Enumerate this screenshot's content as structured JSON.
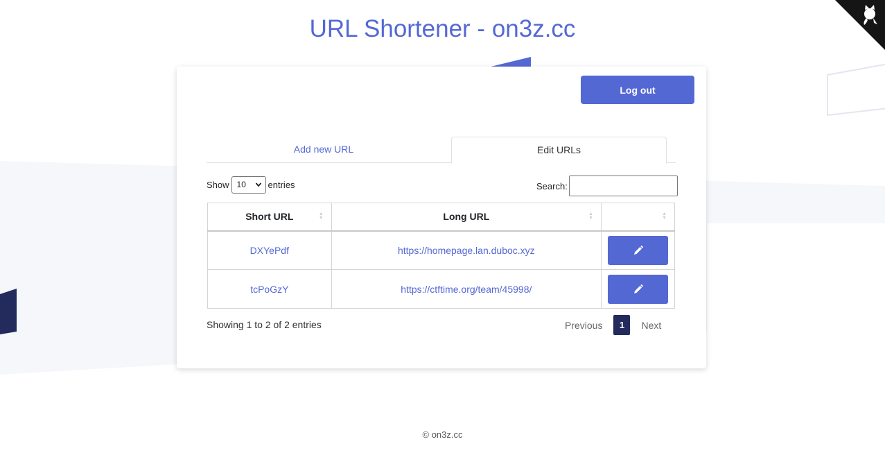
{
  "page": {
    "title": "URL Shortener - on3z.cc",
    "footer": "© on3z.cc"
  },
  "colors": {
    "accent": "#5468d4",
    "dark": "#232b5c"
  },
  "header": {
    "logout_label": "Log out"
  },
  "tabs": [
    {
      "label": "Add new URL",
      "active": false
    },
    {
      "label": "Edit URLs",
      "active": true
    }
  ],
  "table_controls": {
    "show_label": "Show",
    "entries_label": "entries",
    "page_length": "10",
    "search_label": "Search:",
    "search_value": ""
  },
  "table": {
    "columns": [
      "Short URL",
      "Long URL",
      ""
    ],
    "rows": [
      {
        "short": "DXYePdf",
        "long": "https://homepage.lan.duboc.xyz",
        "action_icon": "pencil-icon"
      },
      {
        "short": "tcPoGzY",
        "long": "https://ctftime.org/team/45998/",
        "action_icon": "pencil-icon"
      }
    ]
  },
  "pagination": {
    "info": "Showing 1 to 2 of 2 entries",
    "previous": "Previous",
    "current": "1",
    "next": "Next"
  },
  "corner_icon": "github-octocat-icon"
}
